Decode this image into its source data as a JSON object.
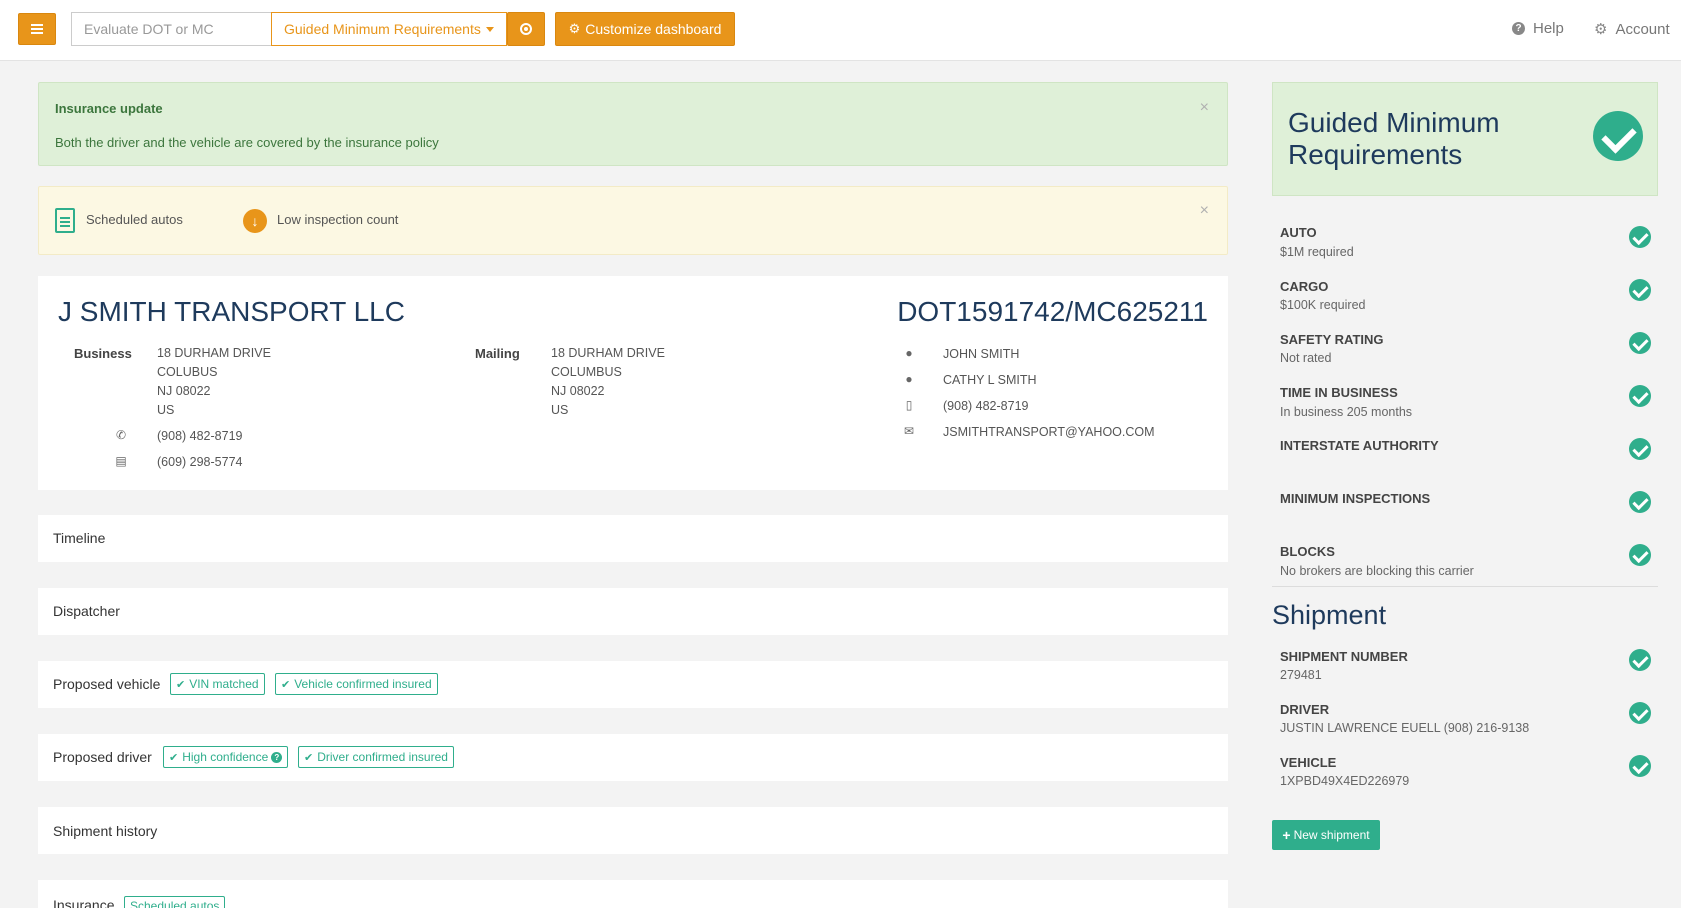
{
  "header": {
    "search_placeholder": "Evaluate DOT or MC",
    "guided_select": "Guided Minimum Requirements",
    "customize_label": "Customize dashboard",
    "help_label": "Help",
    "account_label": "Account"
  },
  "alerts": {
    "insurance_title": "Insurance update",
    "insurance_message": "Both the driver and the vehicle are covered by the insurance policy",
    "warn_1": "Scheduled autos",
    "warn_2": "Low inspection count",
    "close": "×"
  },
  "company": {
    "name": "J SMITH TRANSPORT LLC",
    "dot_mc": "DOT1591742/MC625211",
    "business_label": "Business",
    "business_address": [
      "18 DURHAM DRIVE",
      "COLUBUS",
      "NJ 08022",
      "US"
    ],
    "phone": "(908) 482-8719",
    "fax": "(609) 298-5774",
    "mailing_label": "Mailing",
    "mailing_address": [
      "18 DURHAM DRIVE",
      "COLUMBUS",
      "NJ 08022",
      "US"
    ],
    "contact_1": "JOHN SMITH",
    "contact_2": "CATHY L SMITH",
    "mobile": "(908) 482-8719",
    "email": "JSMITHTRANSPORT@YAHOO.COM"
  },
  "panels": {
    "timeline": "Timeline",
    "dispatcher": "Dispatcher",
    "proposed_vehicle": "Proposed vehicle",
    "vin_matched": "VIN matched",
    "vehicle_insured": "Vehicle confirmed insured",
    "proposed_driver": "Proposed driver",
    "high_confidence": "High confidence",
    "driver_insured": "Driver confirmed insured",
    "shipment_history": "Shipment history",
    "insurance": "Insurance",
    "scheduled_autos": "Scheduled autos"
  },
  "requirements": {
    "title": "Guided Minimum Requirements",
    "items": [
      {
        "title": "AUTO",
        "sub": "$1M required"
      },
      {
        "title": "CARGO",
        "sub": "$100K required"
      },
      {
        "title": "SAFETY RATING",
        "sub": "Not rated"
      },
      {
        "title": "TIME IN BUSINESS",
        "sub": "In business 205 months"
      },
      {
        "title": "INTERSTATE AUTHORITY",
        "sub": ""
      },
      {
        "title": "MINIMUM INSPECTIONS",
        "sub": ""
      },
      {
        "title": "BLOCKS",
        "sub": "No brokers are blocking this carrier"
      }
    ]
  },
  "shipment": {
    "title": "Shipment",
    "items": [
      {
        "title": "SHIPMENT NUMBER",
        "sub": "279481"
      },
      {
        "title": "DRIVER",
        "sub": "JUSTIN LAWRENCE EUELL (908) 216-9138"
      },
      {
        "title": "VEHICLE",
        "sub": "1XPBD49X4ED226979"
      }
    ],
    "new_button": "New shipment"
  },
  "colors": {
    "accent_orange": "#e8951a",
    "success_green": "#2fae8c",
    "heading_navy": "#1e3a5c"
  }
}
